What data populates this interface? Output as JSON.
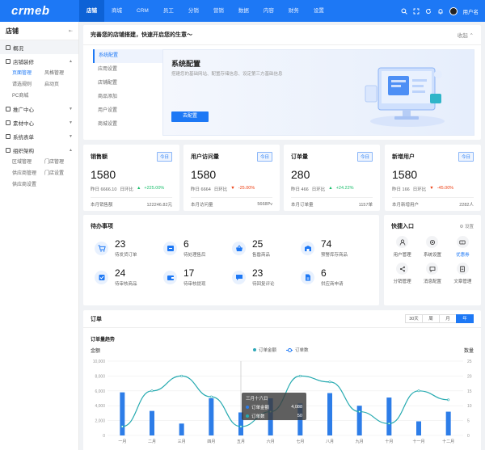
{
  "app": {
    "logo": "crmeb"
  },
  "topnav": {
    "items": [
      {
        "label": "店铺",
        "active": true
      },
      {
        "label": "商城"
      },
      {
        "label": "CRM"
      },
      {
        "label": "员工"
      },
      {
        "label": "分销"
      },
      {
        "label": "营销"
      },
      {
        "label": "数据"
      },
      {
        "label": "内容"
      },
      {
        "label": "财务"
      },
      {
        "label": "设置"
      }
    ],
    "username": "用户名"
  },
  "sidebar": {
    "title": "店铺",
    "items": [
      {
        "label": "概况"
      },
      {
        "label": "店铺装修",
        "children": [
          "页面管理",
          "风格管理",
          "请选规则",
          "启动页",
          "PC商城"
        ]
      },
      {
        "label": "推广中心"
      },
      {
        "label": "素材中心"
      },
      {
        "label": "系统表单"
      },
      {
        "label": "组织架构",
        "children": [
          "区域管理",
          "门店管理",
          "供应商管理",
          "门店设置",
          "供应商设置"
        ]
      }
    ]
  },
  "guide": {
    "title": "完善您的店铺搭建，快速开启您的生意～",
    "collapse": "收起",
    "menu": [
      "系统配置",
      "应用设置",
      "店铺配置",
      "商品添加",
      "用户设置",
      "商城设置"
    ],
    "panel_title": "系统配置",
    "panel_desc": "搭建您的基础网站、配置存储信息、设定第三方基础信息",
    "button": "去配置"
  },
  "stats": [
    {
      "title": "销售额",
      "tag": "今日",
      "value": "1580",
      "yesterday": "昨日 6666.10",
      "ring_label": "日环比",
      "ring": "+225.00%",
      "trend": "up",
      "foot_label": "本月销售额",
      "foot_value": "122246.82元"
    },
    {
      "title": "用户访问量",
      "tag": "今日",
      "value": "1580",
      "yesterday": "昨日 6664",
      "ring_label": "日环比",
      "ring": "-25.00%",
      "trend": "down",
      "foot_label": "本月访问量",
      "foot_value": "5668Pv"
    },
    {
      "title": "订单量",
      "tag": "今日",
      "value": "280",
      "yesterday": "昨日 466",
      "ring_label": "日环比",
      "ring": "+24.22%",
      "trend": "up",
      "foot_label": "本月订单量",
      "foot_value": "1157单"
    },
    {
      "title": "新增用户",
      "tag": "今日",
      "value": "1580",
      "yesterday": "昨日 166",
      "ring_label": "日环比",
      "ring": "-45.00%",
      "trend": "down",
      "foot_label": "本月新增用户",
      "foot_value": "2282人"
    }
  ],
  "todo": {
    "title": "待办事项",
    "items": [
      {
        "num": "23",
        "label": "待发货订单",
        "icon": "cart-icon"
      },
      {
        "num": "6",
        "label": "待处理售后",
        "icon": "return-icon"
      },
      {
        "num": "25",
        "label": "售罄商品",
        "icon": "basket-icon"
      },
      {
        "num": "74",
        "label": "预警库存商品",
        "icon": "warehouse-icon"
      },
      {
        "num": "24",
        "label": "待审核商品",
        "icon": "audit-icon"
      },
      {
        "num": "17",
        "label": "待审核提现",
        "icon": "wallet-icon"
      },
      {
        "num": "23",
        "label": "待回复评论",
        "icon": "comment-icon"
      },
      {
        "num": "6",
        "label": "供应商申请",
        "icon": "file-icon"
      }
    ]
  },
  "quick": {
    "title": "快捷入口",
    "settings": "设置",
    "items": [
      {
        "label": "用户管理",
        "icon": "user-icon"
      },
      {
        "label": "系统设置",
        "icon": "gear-icon"
      },
      {
        "label": "优惠券",
        "icon": "coupon-icon",
        "active": true
      },
      {
        "label": "分销管理",
        "icon": "share-icon"
      },
      {
        "label": "消息配置",
        "icon": "message-icon"
      },
      {
        "label": "文章管理",
        "icon": "article-icon"
      }
    ]
  },
  "orders": {
    "title": "订单",
    "tabs": [
      "30天",
      "周",
      "月",
      "年"
    ],
    "active_tab": "年",
    "subtitle": "订单量趋势",
    "left_label": "金额",
    "right_label": "数量",
    "legend": [
      "订单金额",
      "订单数"
    ],
    "tooltip": {
      "title": "三月十六日",
      "rows": [
        {
          "label": "订单金额",
          "value": "4,088"
        },
        {
          "label": "订单数",
          "value": "50"
        }
      ]
    }
  },
  "chart_data": {
    "type": "bar",
    "categories": [
      "一月",
      "二月",
      "三月",
      "四月",
      "五月",
      "六月",
      "七月",
      "八月",
      "九月",
      "十月",
      "十一月",
      "十二月"
    ],
    "series": [
      {
        "name": "订单金额",
        "type": "bar",
        "axis": "left",
        "values": [
          5800,
          3300,
          1600,
          5000,
          3100,
          5000,
          4300,
          5700,
          4000,
          5100,
          1900,
          3200
        ]
      },
      {
        "name": "订单数",
        "type": "line",
        "axis": "right",
        "values": [
          3,
          15,
          20,
          13,
          3,
          8,
          20,
          18,
          8,
          4,
          15,
          12
        ]
      }
    ],
    "ylim_left": [
      0,
      10000
    ],
    "yticks_left": [
      "0",
      "2,000",
      "4,000",
      "6,000",
      "8,000",
      "10,000"
    ],
    "ylim_right": [
      0,
      25
    ],
    "yticks_right": [
      "0",
      "5",
      "10",
      "15",
      "20",
      "25"
    ],
    "colors": {
      "bar": "#2d7de8",
      "line": "#26aab0"
    }
  }
}
